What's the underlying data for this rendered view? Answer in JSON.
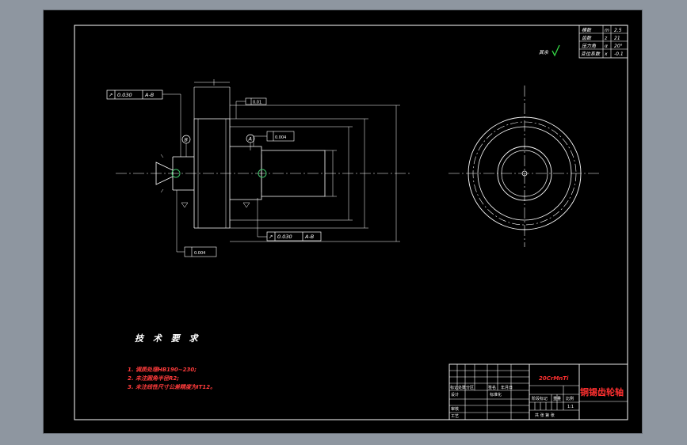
{
  "gear_table": {
    "rows": [
      {
        "label": "模数",
        "symbol": "m",
        "value": "2.5"
      },
      {
        "label": "齿数",
        "symbol": "z",
        "value": "21"
      },
      {
        "label": "压力角",
        "symbol": "α",
        "value": "20°"
      },
      {
        "label": "变位系数",
        "symbol": "x",
        "value": "-0.1"
      }
    ]
  },
  "surface_finish": {
    "label": "其余"
  },
  "tolerances": {
    "runout_top": {
      "symbol": "↗",
      "value": "0.030",
      "datum": "A-B"
    },
    "runout_bottom": {
      "symbol": "↗",
      "value": "0.030",
      "datum": "A-B"
    },
    "cyl_a": {
      "value": "0.004"
    },
    "cyl_b": {
      "value": "0.004"
    },
    "perp_top": {
      "value": "0.01"
    }
  },
  "datums": {
    "a": "A",
    "b": "B"
  },
  "tech_requirements": {
    "title": "技 术 要 求",
    "items": [
      "1. 调质处理HB190~230;",
      "2. 未注圆角半径R2;",
      "3. 未注线性尺寸公差精度为IT12。"
    ]
  },
  "title_block": {
    "material": "20CrMnTi",
    "part_name": "铜锡齿轮轴",
    "design_label": "设计",
    "check_label": "审核",
    "process_label": "工艺",
    "stage_label": "阶段标记",
    "weight_label": "重量",
    "scale_label": "比例",
    "scale_value": "1:1",
    "sheets_label": "共 张 第 张",
    "std_label": "标准化",
    "revision_label": "标记处数分区",
    "signature_label": "签名",
    "date_label": "年月日"
  },
  "colors": {
    "lines": "#ffffff",
    "accent_red": "#ff3030",
    "check_green": "#35d645",
    "datum_green": "#3fc46a"
  }
}
